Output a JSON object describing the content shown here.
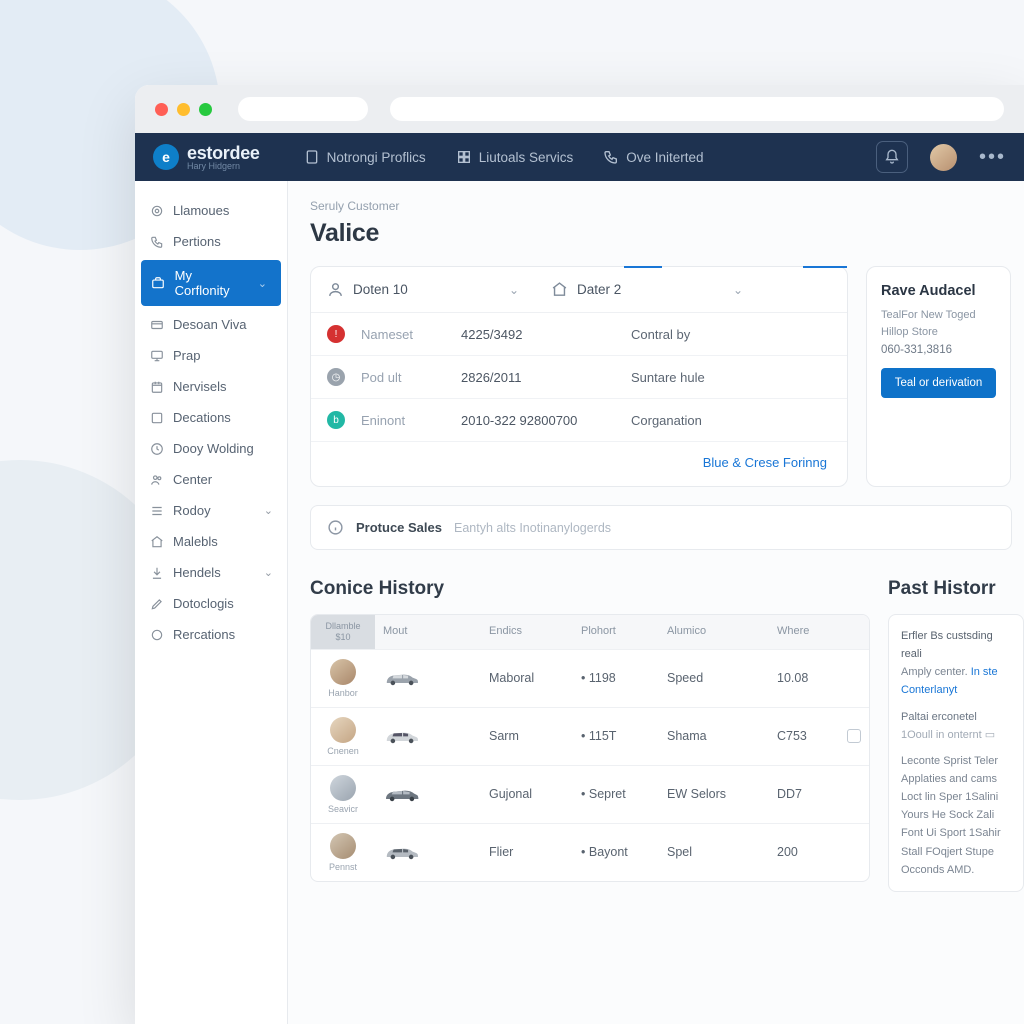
{
  "brand": {
    "name": "estordee",
    "sub": "Hary Hidgern"
  },
  "nav": [
    {
      "label": "Notrongi Proflics"
    },
    {
      "label": "Liutoals Servics"
    },
    {
      "label": "Ove Initerted"
    }
  ],
  "sidebar": {
    "items": [
      {
        "label": "Llamoues"
      },
      {
        "label": "Pertions"
      },
      {
        "label": "My Corflonity",
        "active": true,
        "chev": true
      },
      {
        "label": "Desoan Viva"
      },
      {
        "label": "Prap"
      },
      {
        "label": "Nervisels"
      },
      {
        "label": "Decations"
      },
      {
        "label": "Dooy Wolding"
      },
      {
        "label": "Center"
      },
      {
        "label": "Rodoy",
        "chev": true
      },
      {
        "label": "Malebls"
      },
      {
        "label": "Hendels",
        "chev": true
      },
      {
        "label": "Dotoclogis"
      },
      {
        "label": "Rercations"
      }
    ]
  },
  "crumb": "Seruly Customer",
  "page_title": "Valice",
  "tabs": [
    {
      "label": "Doten 10"
    },
    {
      "label": "Dater 2"
    }
  ],
  "detail_rows": [
    {
      "bullet": "red",
      "lbl": "Nameset",
      "val": "4225/3492",
      "val2": "Contral by"
    },
    {
      "bullet": "gray",
      "lbl": "Pod ult",
      "val": "2826/2011",
      "val2": "Suntare hule"
    },
    {
      "bullet": "teal",
      "lbl": "Eninont",
      "val": "2010-322 92800700",
      "val2": "Corganation"
    }
  ],
  "detail_footer": "Blue & Crese Forinng",
  "promo": {
    "title": "Rave Audacel",
    "body": "TealFor New Toged Hillop Store",
    "num": "060-331,3816",
    "button": "Teal or derivation"
  },
  "banner": {
    "label": "Protuce Sales",
    "desc": "Eantyh alts Inotinanylogerds"
  },
  "history": {
    "title": "Conice History",
    "head0_line1": "Dllamble",
    "head0_line2": "$10",
    "columns": [
      "Mout",
      "Endics",
      "Plohort",
      "Alumico",
      "Where"
    ],
    "rows": [
      {
        "name": "Hanbor",
        "c1": "Maboral",
        "c2": "1198",
        "c3": "Speed",
        "c4": "10.08"
      },
      {
        "name": "Cnenen",
        "c1": "Sarm",
        "c2": "115T",
        "c3": "Shama",
        "c4": "C753",
        "chk": true
      },
      {
        "name": "Seavicr",
        "c1": "Gujonal",
        "c2": "Sepret",
        "c3": "EW Selors",
        "c4": "DD7"
      },
      {
        "name": "Pennst",
        "c1": "Flier",
        "c2": "Bayont",
        "c3": "Spel",
        "c4": "200"
      }
    ]
  },
  "past": {
    "title": "Past Historr",
    "l1": "Erfler Bs custsding reali",
    "l2a": "Amply center.",
    "l2b": "In ste",
    "l3": "Conterlanyt",
    "l4": "Paltai erconetel",
    "l5": "1Ooull in onternt",
    "body": "Leconte Sprist Teler Applaties and cams Loct lin Sper 1Salini Yours He Sock Zali Font Ui Sport 1Sahir Stall FOqjert Stupe Occonds AMD."
  }
}
